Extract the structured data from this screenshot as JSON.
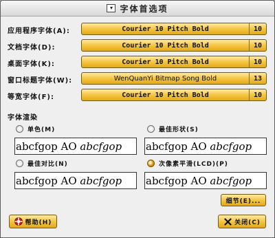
{
  "window": {
    "title": "字体首选项"
  },
  "fonts": [
    {
      "label": "应用程序字体(A):",
      "font": "Courier 10 Pitch Bold",
      "size": "10"
    },
    {
      "label": "文档字体(D):",
      "font": "Courier 10 Pitch Bold",
      "size": "10"
    },
    {
      "label": "桌面字体(K):",
      "font": "Courier 10 Pitch Bold",
      "size": "10"
    },
    {
      "label": "窗口标题字体(W):",
      "font": "WenQuanYi Bitmap Song Bold",
      "size": "13"
    },
    {
      "label": "等宽字体(F):",
      "font": "Courier 10 Pitch Bold",
      "size": "10"
    }
  ],
  "rendering": {
    "title": "字体渲染",
    "options": [
      {
        "label": "单色(M)",
        "selected": false
      },
      {
        "label": "最佳形状(S)",
        "selected": false
      },
      {
        "label": "最佳对比(N)",
        "selected": false
      },
      {
        "label": "次像素平滑(LCD)(P)",
        "selected": true
      }
    ],
    "sample_plain": "abcfgop AO ",
    "sample_italic": "abcfgop"
  },
  "buttons": {
    "details": "细节(E)...",
    "help": "帮助(H)",
    "close": "关闭(C)"
  },
  "colors": {
    "accent": "#f3c23a",
    "accent_border": "#6e5a10"
  }
}
